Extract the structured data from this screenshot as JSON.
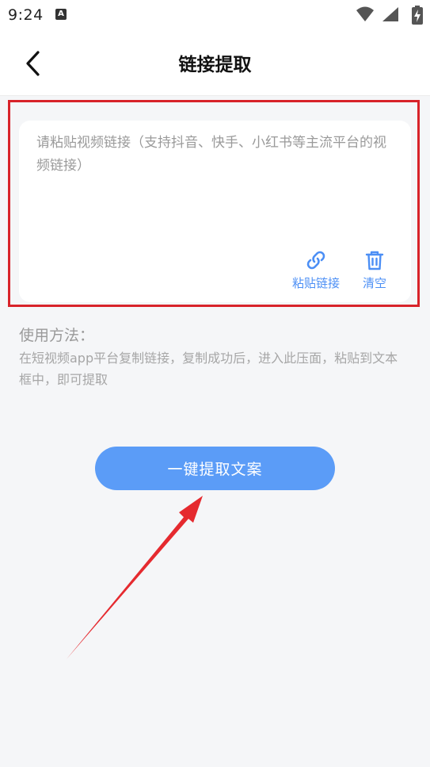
{
  "status_bar": {
    "time": "9:24",
    "notification_icon": "a-letter-icon",
    "right_icons": [
      "wifi-icon",
      "signal-icon",
      "battery-charging-icon"
    ]
  },
  "header": {
    "title": "链接提取",
    "back_icon": "chevron-left-icon"
  },
  "input_card": {
    "value": "",
    "placeholder": "请粘贴视频链接（支持抖音、快手、小红书等主流平台的视频链接）",
    "paste_label": "粘贴链接",
    "paste_icon": "link-icon",
    "clear_label": "清空",
    "clear_icon": "trash-icon"
  },
  "usage": {
    "title": "使用方法：",
    "description": "在短视频app平台复制链接，复制成功后，进入此压面，粘贴到文本框中，即可提取"
  },
  "primary_button": {
    "label": "一键提取文案"
  },
  "colors": {
    "accent": "#5b9cf7",
    "action_blue": "#4c8ff5",
    "highlight_red": "#d8232a",
    "background": "#f5f6f8"
  }
}
